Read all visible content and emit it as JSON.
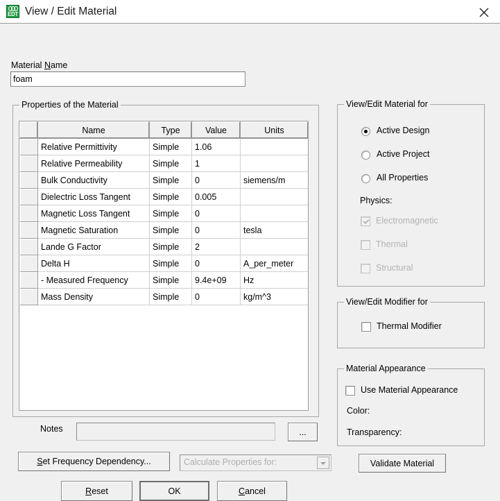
{
  "window": {
    "title": "View / Edit Material",
    "icon": "edt-app-icon",
    "icon_text": "EDT",
    "close_label": "✕"
  },
  "material_name": {
    "label_pre": "Material ",
    "label_accel": "N",
    "label_post": "ame",
    "value": "foam",
    "placeholder": ""
  },
  "properties_group": {
    "title": "Properties of the Material",
    "columns": [
      "",
      "Name",
      "Type",
      "Value",
      "Units"
    ],
    "rows": [
      {
        "name": "Relative Permittivity",
        "type": "Simple",
        "value": "1.06",
        "units": ""
      },
      {
        "name": "Relative Permeability",
        "type": "Simple",
        "value": "1",
        "units": ""
      },
      {
        "name": "Bulk Conductivity",
        "type": "Simple",
        "value": "0",
        "units": "siemens/m"
      },
      {
        "name": "Dielectric Loss Tangent",
        "type": "Simple",
        "value": "0.005",
        "units": ""
      },
      {
        "name": "Magnetic Loss Tangent",
        "type": "Simple",
        "value": "0",
        "units": ""
      },
      {
        "name": "Magnetic Saturation",
        "type": "Simple",
        "value": "0",
        "units": "tesla"
      },
      {
        "name": "Lande G Factor",
        "type": "Simple",
        "value": "2",
        "units": ""
      },
      {
        "name": "Delta H",
        "type": "Simple",
        "value": "0",
        "units": "A_per_meter"
      },
      {
        "name": "-  Measured Frequency",
        "type": "Simple",
        "value": "9.4e+09",
        "units": "Hz"
      },
      {
        "name": "Mass Density",
        "type": "Simple",
        "value": "0",
        "units": "kg/m^3"
      }
    ]
  },
  "view_edit_material_for": {
    "title": "View/Edit Material for",
    "options": [
      {
        "label": "Active Design",
        "selected": true
      },
      {
        "label": "Active Project",
        "selected": false
      },
      {
        "label": "All Properties",
        "selected": false
      }
    ],
    "physics_label": "Physics:",
    "physics": [
      {
        "label": "Electromagnetic",
        "checked": true,
        "disabled": true
      },
      {
        "label": "Thermal",
        "checked": false,
        "disabled": true
      },
      {
        "label": "Structural",
        "checked": false,
        "disabled": true
      }
    ]
  },
  "view_edit_modifier_for": {
    "title": "View/Edit Modifier for",
    "thermal_modifier": {
      "label": "Thermal Modifier",
      "checked": false
    }
  },
  "material_appearance": {
    "title": "Material Appearance",
    "use_label": "Use Material Appearance",
    "use_checked": false,
    "color_label": "Color:",
    "transparency_label": "Transparency:"
  },
  "notes": {
    "label": "Notes",
    "value": "",
    "placeholder": "",
    "browse_label": "..."
  },
  "bottom": {
    "set_frequency_pre": "S",
    "set_frequency_post": "et Frequency Dependency...",
    "calculate_for_placeholder": "Calculate Properties for:",
    "validate_label": "Validate Material",
    "reset_pre": "R",
    "reset_post": "eset",
    "ok_pre": "O",
    "ok_post": "K",
    "cancel_pre": "C",
    "cancel_post": "ancel"
  },
  "colors": {
    "window_bg": "#f0f0f0",
    "titlebar_bg": "#ffffff",
    "field_bg": "#ffffff",
    "border": "#a7a7a7",
    "disabled_text": "#b3b3b3",
    "icon_green": "#1f9a41"
  }
}
